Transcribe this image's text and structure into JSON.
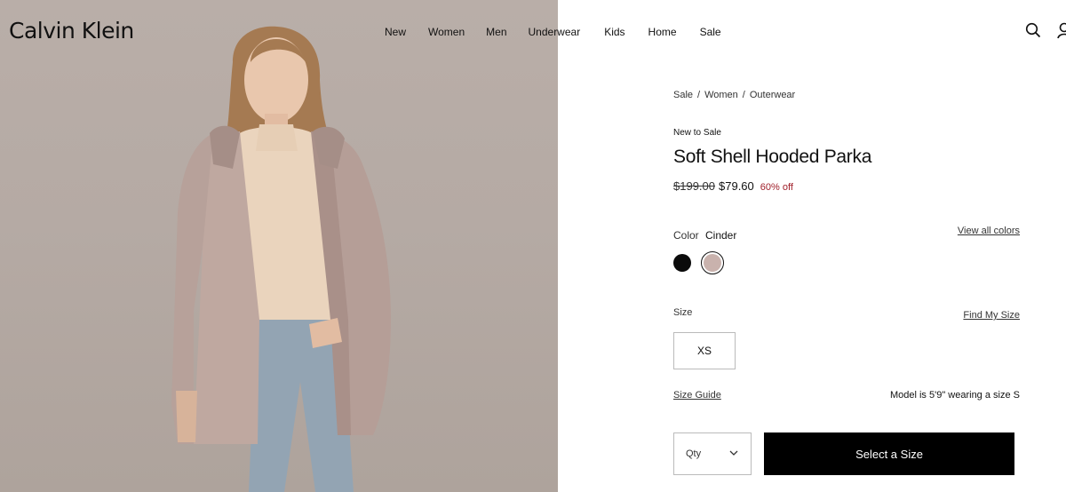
{
  "header": {
    "brand": "Calvin Klein",
    "nav": [
      "New",
      "Women",
      "Men",
      "Underwear",
      "Kids",
      "Home",
      "Sale"
    ],
    "icons": [
      "search-icon",
      "account-icon"
    ]
  },
  "product": {
    "breadcrumb": [
      "Sale",
      "Women",
      "Outerwear"
    ],
    "badge": "New to Sale",
    "title": "Soft Shell Hooded Parka",
    "price_original": "$199.00",
    "price_sale": "$79.60",
    "discount": "60% off",
    "color_label": "Color",
    "color_value": "Cinder",
    "view_all_colors": "View all colors",
    "swatches": [
      {
        "name": "Black",
        "hex": "#0b0b0b",
        "selected": false
      },
      {
        "name": "Cinder",
        "hex": "#c9b2ad",
        "selected": true
      }
    ],
    "size_label": "Size",
    "find_my_size": "Find My Size",
    "sizes": [
      "XS"
    ],
    "size_guide": "Size Guide",
    "model_info": "Model is 5'9\" wearing a size S",
    "qty_label": "Qty",
    "cta": "Select a Size"
  },
  "colors": {
    "accent_sale": "#a0202b",
    "cta_bg": "#000000",
    "cta_text": "#ffffff"
  }
}
